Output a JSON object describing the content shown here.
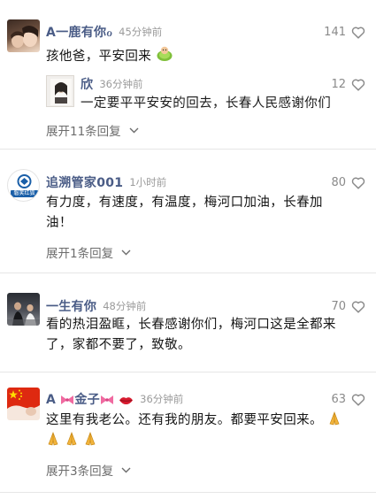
{
  "comments": [
    {
      "username": "A一鹿有你ℴ",
      "time": "45分钟前",
      "likes": "141",
      "text": "孩他爸，平安回来",
      "reply": {
        "username": "欣",
        "time": "36分钟前",
        "likes": "12",
        "text": "一定要平平安安的回去，长春人民感谢你们"
      },
      "expand": "展开11条回复"
    },
    {
      "username": "追溯管家001",
      "time": "1小时前",
      "likes": "80",
      "avatar_text": "磐笑红狐",
      "text_lines": [
        "有力度，有速度，有温度，梅河口加油，长春加",
        "油！"
      ],
      "expand": "展开1条回复"
    },
    {
      "username": "一生有你",
      "time": "48分钟前",
      "likes": "70",
      "text_lines": [
        "看的热泪盈眶，长春感谢你们，梅河口这是全都来",
        "了，家都不要了，致敬。"
      ]
    },
    {
      "username_pre": "A",
      "username_mid": "金子",
      "time": "36分钟前",
      "likes": "63",
      "text_lines": [
        "这里有我老公。还有我的朋友。都要平安回来。"
      ],
      "expand": "展开3条回复"
    }
  ],
  "colors": {
    "username": "#4a5c86",
    "meta": "#9a9a9a",
    "text": "#151515",
    "divider": "#e6e6e6",
    "flag_red": "#de2910",
    "flag_star": "#ffde00"
  },
  "icons": [
    "heart-outline-icon",
    "chevron-down-icon",
    "bow-emoji-icon",
    "lips-emoji-icon",
    "praying-hands-emoji-icon",
    "cabbage-emoji-icon"
  ]
}
